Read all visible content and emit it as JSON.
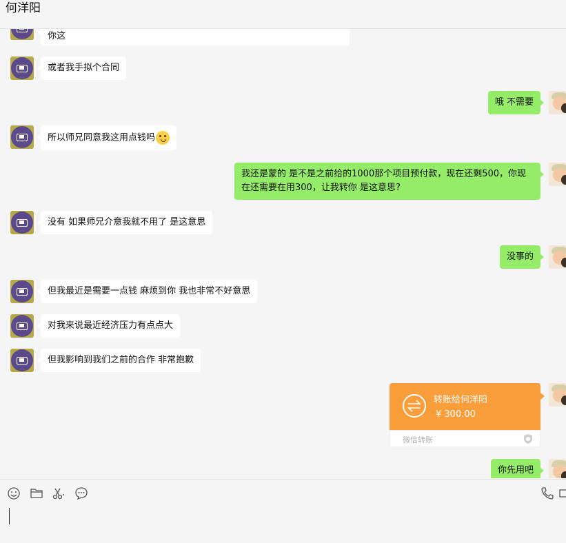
{
  "header": {
    "title": "何洋阳"
  },
  "messages": [
    {
      "side": "in",
      "text": "你这"
    },
    {
      "side": "in",
      "text": "或者我手拟个合同"
    },
    {
      "side": "out",
      "text": "哦 不需要"
    },
    {
      "side": "in",
      "text": "所以师兄同意我这用点钱吗"
    },
    {
      "side": "out",
      "text": "我还是蒙的 是不是之前给的1000那个项目预付款，现在还剩500，你现在还需要在用300，让我转你 是这意思?"
    },
    {
      "side": "in",
      "text": "没有 如果师兄介意我就不用了 是这意思"
    },
    {
      "side": "out",
      "text": "没事的"
    },
    {
      "side": "in",
      "text": "但我最近是需要一点钱 麻烦到你 我也非常不好意思"
    },
    {
      "side": "in",
      "text": "对我来说最近经济压力有点点大"
    },
    {
      "side": "in",
      "text": "但我影响到我们之前的合作 非常抱歉"
    },
    {
      "side": "out",
      "text": "你先用吧"
    }
  ],
  "transfer": {
    "title": "转账给何洋阳",
    "amount": "¥ 300.00",
    "footer": "微信转账",
    "color": "#fa9d3b"
  },
  "toolbar": {
    "icons": [
      "emoji-icon",
      "folder-icon",
      "scissors-icon",
      "chat-history-icon",
      "phone-icon",
      "video-icon"
    ]
  },
  "colors": {
    "outgoing_bubble": "#95ec69",
    "incoming_bubble": "#ffffff",
    "background": "#f5f5f5"
  }
}
